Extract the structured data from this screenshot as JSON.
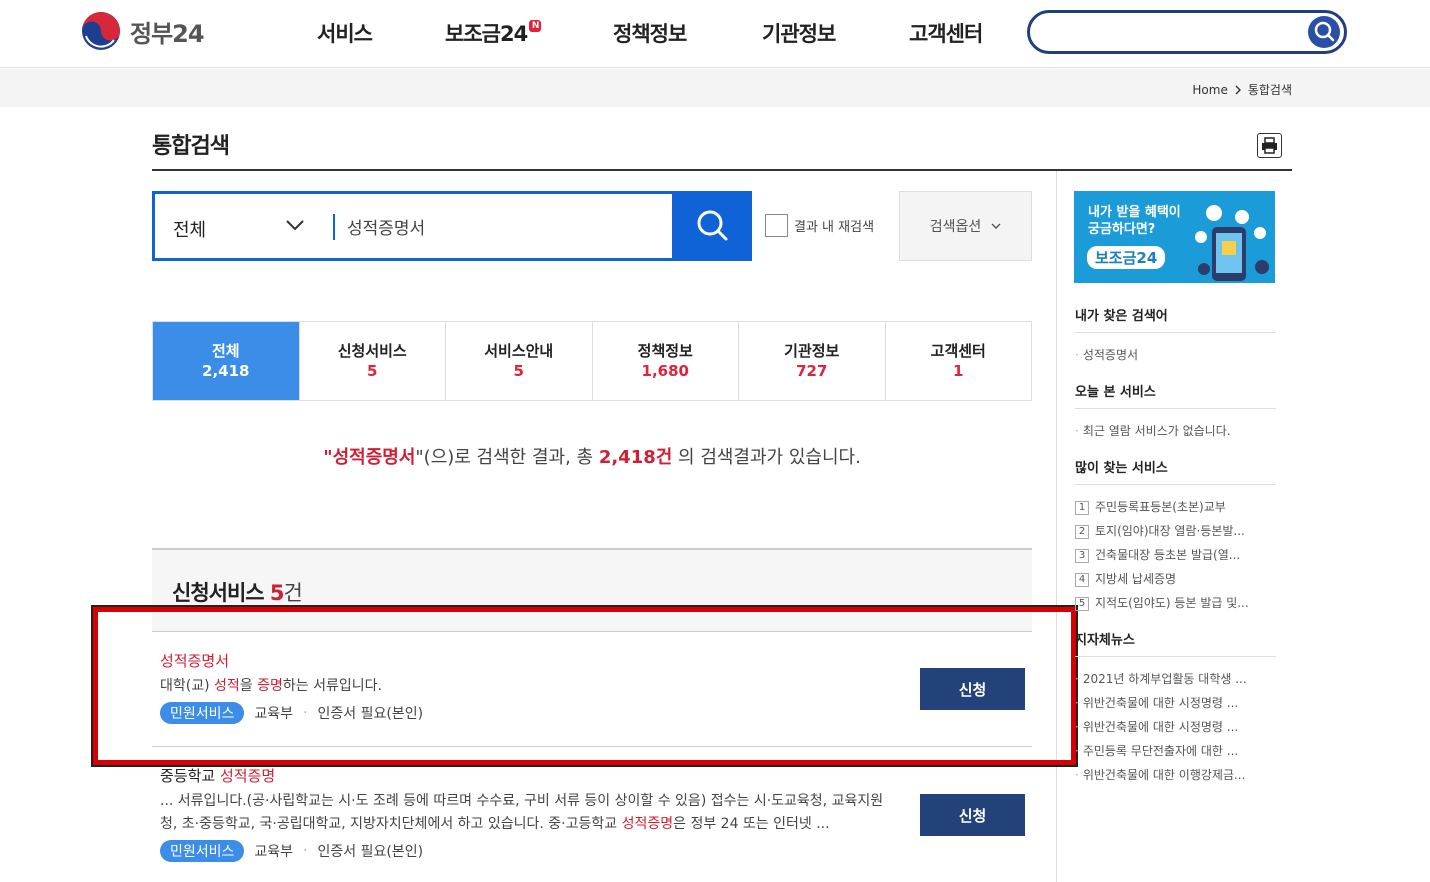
{
  "header": {
    "logo_text": "정부24",
    "nav": [
      {
        "label": "서비스"
      },
      {
        "label": "보조금24",
        "badge": "N"
      },
      {
        "label": "정책정보"
      },
      {
        "label": "기관정보"
      },
      {
        "label": "고객센터"
      }
    ],
    "search_value": ""
  },
  "breadcrumb": {
    "home": "Home",
    "current": "통합검색"
  },
  "page": {
    "title": "통합검색"
  },
  "search": {
    "category": "전체",
    "query": "성적증명서",
    "research_label": "결과 내 재검색",
    "options_label": "검색옵션"
  },
  "tabs": [
    {
      "label": "전체",
      "count": "2,418",
      "active": true
    },
    {
      "label": "신청서비스",
      "count": "5"
    },
    {
      "label": "서비스안내",
      "count": "5"
    },
    {
      "label": "정책정보",
      "count": "1,680"
    },
    {
      "label": "기관정보",
      "count": "727"
    },
    {
      "label": "고객센터",
      "count": "1"
    }
  ],
  "summary": {
    "open_quote": "\"",
    "query": "성적증명서",
    "mid": "\"(으)로 검색한 결과, 총 ",
    "total": "2,418건",
    "tail": " 의 검색결과가 있습니다."
  },
  "section": {
    "title": "신청서비스",
    "count": "5",
    "unit": "건"
  },
  "results": [
    {
      "title_parts": [
        {
          "t": "성적증명서",
          "red": true
        }
      ],
      "desc_parts": [
        {
          "t": "대학(교) "
        },
        {
          "t": "성적",
          "red": true
        },
        {
          "t": "을 "
        },
        {
          "t": "증명",
          "red": true
        },
        {
          "t": "하는 서류입니다."
        }
      ],
      "chip": "민원서비스",
      "org": "교육부",
      "cert": "인증서 필요(본인)",
      "button": "신청"
    },
    {
      "title_parts": [
        {
          "t": "중등학교 "
        },
        {
          "t": "성적증명",
          "red": true
        }
      ],
      "desc_parts": [
        {
          "t": "... 서류입니다.(공·사립학교는 시·도 조례 등에 따르며 수수료, 구비 서류 등이 상이할 수 있음) 접수는 시·도교육청, 교육지원청, 초·중등학교, 국·공립대학교, 지방자치단체에서 하고 있습니다. 중·고등학교 "
        },
        {
          "t": "성적증명",
          "red": true
        },
        {
          "t": "은 정부 24 또는 인터넷 ..."
        }
      ],
      "chip": "민원서비스",
      "org": "교육부",
      "cert": "인증서 필요(본인)",
      "button": "신청"
    }
  ],
  "sidebar": {
    "banner": {
      "line1": "내가 받을 혜택이",
      "line2": "궁금하다면?",
      "brand": "보조금24"
    },
    "my_search": {
      "title": "내가 찾은 검색어",
      "items": [
        "성적증명서"
      ]
    },
    "today_seen": {
      "title": "오늘 본 서비스",
      "items": [
        "최근 열람 서비스가 없습니다."
      ]
    },
    "popular": {
      "title": "많이 찾는 서비스",
      "items": [
        "주민등록표등본(초본)교부",
        "토지(임야)대장 열람·등본발...",
        "건축물대장 등초본 발급(열...",
        "지방세 납세증명",
        "지적도(임야도) 등본 발급 및..."
      ]
    },
    "local_news": {
      "title": "지자체뉴스",
      "items": [
        "2021년 하계부업활동 대학생 ...",
        "위반건축물에 대한 시정명령 ...",
        "위반건축물에 대한 시정명령 ...",
        "주민등록 무단전출자에 대한 ...",
        "위반건축물에 대한 이행강제금..."
      ]
    }
  },
  "colors": {
    "primary_blue": "#0f63d6",
    "active_tab": "#3b8de8",
    "navy_button": "#23427a",
    "highlight_red": "#d01f34",
    "frame_red": "#d80000"
  }
}
